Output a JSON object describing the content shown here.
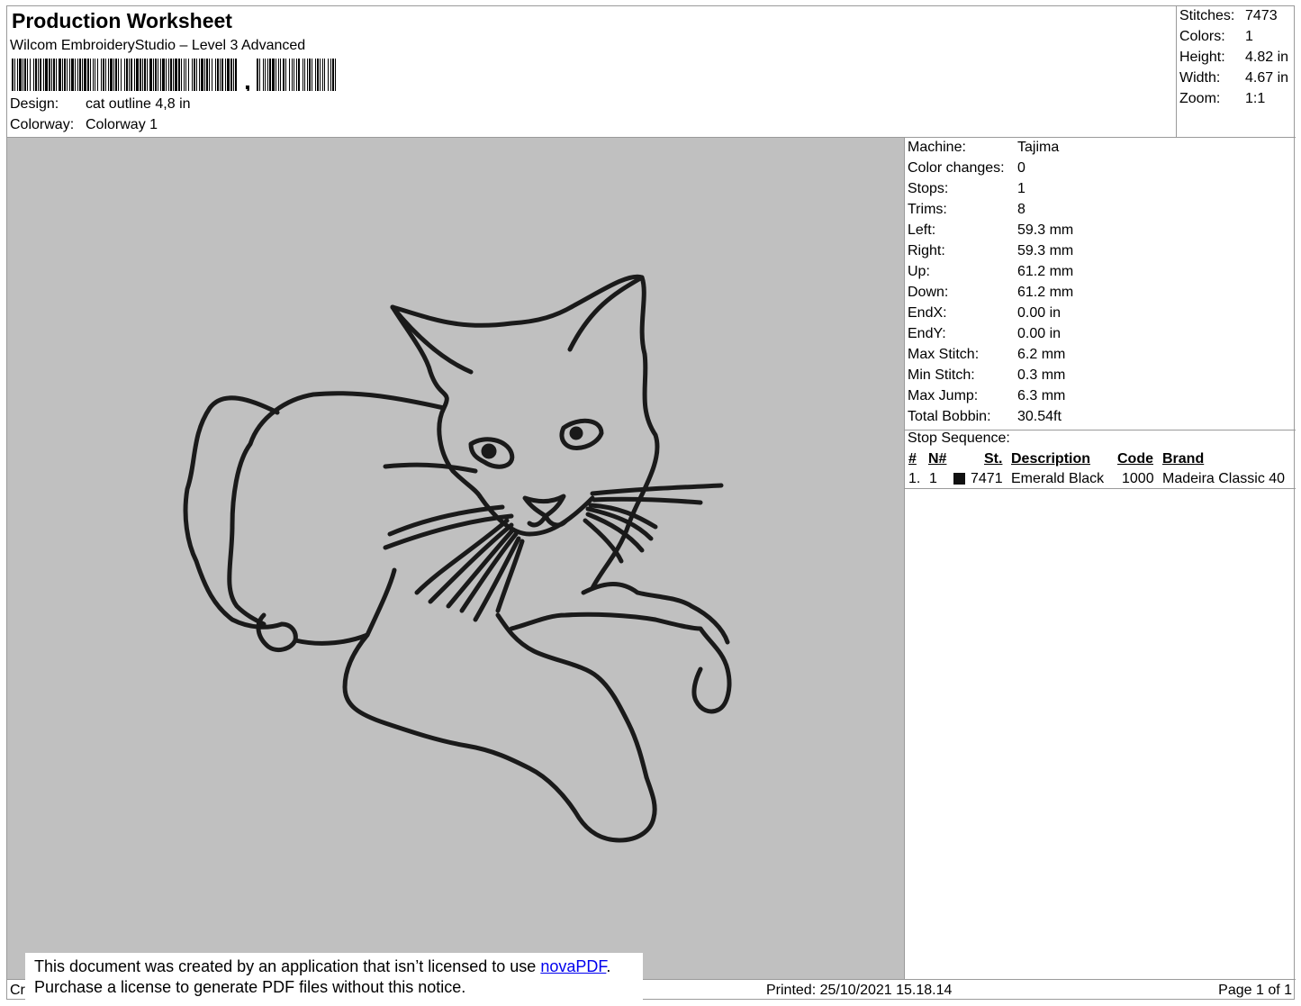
{
  "header": {
    "title": "Production Worksheet",
    "subtitle": "Wilcom EmbroideryStudio – Level 3 Advanced",
    "barcode_label": "barcode",
    "design_label": "Design:",
    "design_value": "cat outline 4,8 in",
    "colorway_label": "Colorway:",
    "colorway_value": "Colorway 1"
  },
  "summary": [
    {
      "label": "Stitches:",
      "value": "7473"
    },
    {
      "label": "Colors:",
      "value": "1"
    },
    {
      "label": "Height:",
      "value": "4.82 in"
    },
    {
      "label": "Width:",
      "value": "4.67 in"
    },
    {
      "label": "Zoom:",
      "value": "1:1"
    }
  ],
  "info": [
    {
      "label": "Machine:",
      "value": "Tajima"
    },
    {
      "label": "Color changes:",
      "value": "0"
    },
    {
      "label": "Stops:",
      "value": "1"
    },
    {
      "label": "Trims:",
      "value": "8"
    },
    {
      "label": "Left:",
      "value": "59.3 mm"
    },
    {
      "label": "Right:",
      "value": "59.3 mm"
    },
    {
      "label": "Up:",
      "value": "61.2 mm"
    },
    {
      "label": "Down:",
      "value": "61.2 mm"
    },
    {
      "label": "EndX:",
      "value": "0.00 in"
    },
    {
      "label": "EndY:",
      "value": "0.00 in"
    },
    {
      "label": "Max Stitch:",
      "value": "6.2 mm"
    },
    {
      "label": "Min Stitch:",
      "value": "0.3 mm"
    },
    {
      "label": "Max Jump:",
      "value": "6.3 mm"
    },
    {
      "label": "Total Bobbin:",
      "value": "30.54ft"
    }
  ],
  "stop_sequence": {
    "title": "Stop Sequence:",
    "columns": [
      "#",
      "N#",
      "St.",
      "Description",
      "Code",
      "Brand"
    ],
    "rows": [
      {
        "index": "1.",
        "n": "1",
        "swatch_color": "#111111",
        "stitches": "7471",
        "description": "Emerald Black",
        "code": "1000",
        "brand": "Madeira Classic 40"
      }
    ]
  },
  "footer": {
    "left": "Cr",
    "printed": "Printed: 25/10/2021 15.18.14",
    "page": "Page 1 of 1"
  },
  "notice": {
    "line1_prefix": "This document was created by an application that isn’t licensed to use ",
    "link": "novaPDF",
    "line1_suffix": ".",
    "line2": "Purchase a license to generate PDF files without this notice."
  },
  "colors": {
    "canvas_background": "#c0c0c0",
    "thread": "#1a1a1a",
    "link": "#0000ee"
  }
}
